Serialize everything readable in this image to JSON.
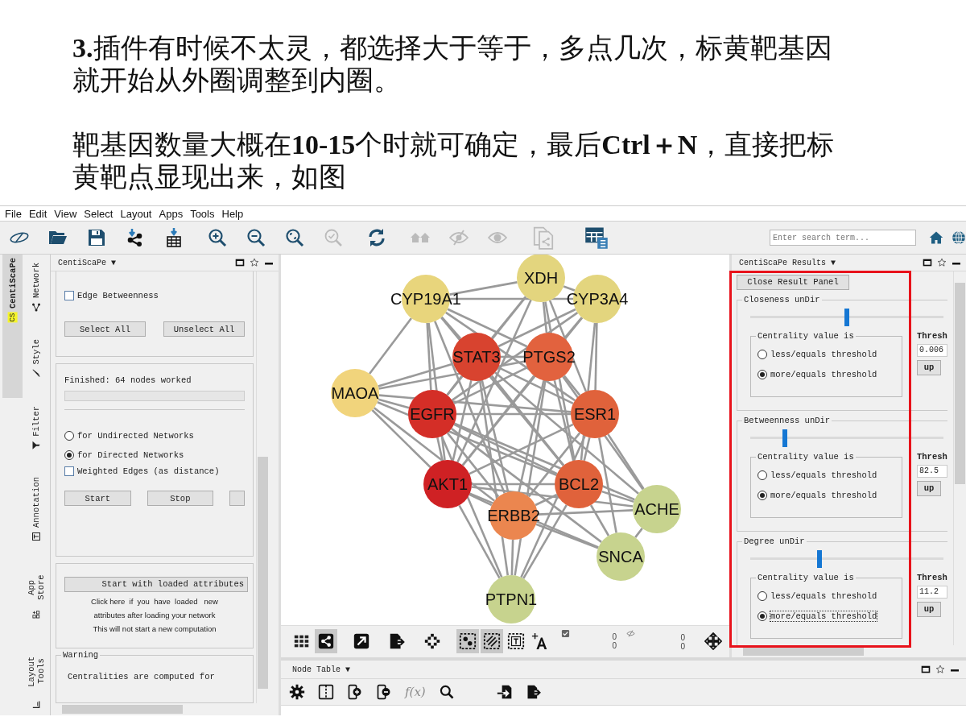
{
  "caption": {
    "paragraphs": [
      "**3.**插件有时候不太灵，都选择大于等于，多点几次，标黄靶基因就开始从外圈调整到内圈。",
      "靶基因数量大概在**10-15**个时就可确定，最后**Ctrl＋N**，直接把标黄靶点显现出来，如图"
    ]
  },
  "menu": [
    "File",
    "Edit",
    "View",
    "Select",
    "Layout",
    "Apps",
    "Tools",
    "Help"
  ],
  "search": {
    "placeholder": "Enter search term..."
  },
  "side_tabs": [
    {
      "label": "CentiScaPe",
      "badge": "CS",
      "selected": true
    },
    {
      "label": "Network",
      "selected": false
    },
    {
      "label": "Style",
      "selected": false
    },
    {
      "label": "Filter",
      "selected": false
    },
    {
      "label": "Annotation",
      "selected": false
    },
    {
      "label": "App Store",
      "selected": false
    },
    {
      "label": "Layout Tools",
      "selected": false
    }
  ],
  "left_panel": {
    "title": "CentiScaPe ▼",
    "edge_betweenness": {
      "label": "Edge Betweenness",
      "checked": false
    },
    "select_buttons": [
      "Select All",
      "Unselect All"
    ],
    "status": "Finished: 64 nodes worked",
    "progress": {
      "level": 0
    },
    "network_types": [
      {
        "label": "for Undirected Networks",
        "selected": false
      },
      {
        "label": "for Directed Networks",
        "selected": true
      }
    ],
    "weighted": {
      "label": "Weighted Edges (as distance)",
      "checked": false
    },
    "run_buttons": [
      "Start",
      "Stop"
    ],
    "loaded_button": "Start with loaded attributes",
    "loaded_notes": [
      "Click here  if  you  have  loaded   new",
      "attributes after loading your network",
      "This will not start a new computation"
    ],
    "warning": {
      "title": "Warning",
      "text": "Centralities are computed for"
    }
  },
  "network": {
    "nodes": [
      {
        "label": "XDH",
        "color": "#e3d57e"
      },
      {
        "label": "CYP19A1",
        "color": "#e8d57c"
      },
      {
        "label": "CYP3A4",
        "color": "#e3d57e"
      },
      {
        "label": "STAT3",
        "color": "#d8432f"
      },
      {
        "label": "PTGS2",
        "color": "#e2623e"
      },
      {
        "label": "MAOA",
        "color": "#f1d47c"
      },
      {
        "label": "EGFR",
        "color": "#d42e27"
      },
      {
        "label": "ESR1",
        "color": "#e0623b"
      },
      {
        "label": "AKT1",
        "color": "#cf2124"
      },
      {
        "label": "BCL2",
        "color": "#e0623b"
      },
      {
        "label": "ACHE",
        "color": "#c7d38e"
      },
      {
        "label": "ERBB2",
        "color": "#eb864f"
      },
      {
        "label": "SNCA",
        "color": "#c7d38e"
      },
      {
        "label": "PTPN1",
        "color": "#c7d38e"
      }
    ]
  },
  "view_toolbar": {
    "tools": [
      {
        "selected": false
      },
      {
        "selected": true
      },
      {
        "selected": false
      },
      {
        "selected": false
      },
      {
        "selected": false
      },
      {
        "selected": true
      },
      {
        "selected": true
      },
      {
        "selected": false
      },
      {
        "selected": false
      }
    ],
    "selected_counts": [
      "0",
      "0"
    ],
    "hidden_counts": [
      "0",
      "0"
    ]
  },
  "results": {
    "title": "CentiScaPe Results ▼",
    "close_button": "Close Result Panel",
    "sections": [
      {
        "title": "Closeness unDir",
        "level": 0.5,
        "group_title": "Centrality value is",
        "options": [
          {
            "label": "less/equals threshold",
            "selected": false,
            "focused": false
          },
          {
            "label": "more/equals threshold",
            "selected": true,
            "focused": false
          }
        ],
        "threshold_label": "Thresh",
        "threshold_value": "0.006",
        "update_button": "up"
      },
      {
        "title": "Betweenness unDir",
        "level": 0.18,
        "group_title": "Centrality value is",
        "options": [
          {
            "label": "less/equals threshold",
            "selected": false,
            "focused": false
          },
          {
            "label": "more/equals threshold",
            "selected": true,
            "focused": false
          }
        ],
        "threshold_label": "Thresh",
        "threshold_value": "82.5",
        "update_button": "up"
      },
      {
        "title": "Degree unDir",
        "level": 0.36,
        "group_title": "Centrality value is",
        "options": [
          {
            "label": "less/equals threshold",
            "selected": false,
            "focused": false
          },
          {
            "label": "more/equals threshold",
            "selected": true,
            "focused": true
          }
        ],
        "threshold_label": "Thresh",
        "threshold_value": "11.2",
        "update_button": "up"
      }
    ]
  },
  "node_table": {
    "title": "Node Table ▼",
    "formula": "f(x)"
  }
}
